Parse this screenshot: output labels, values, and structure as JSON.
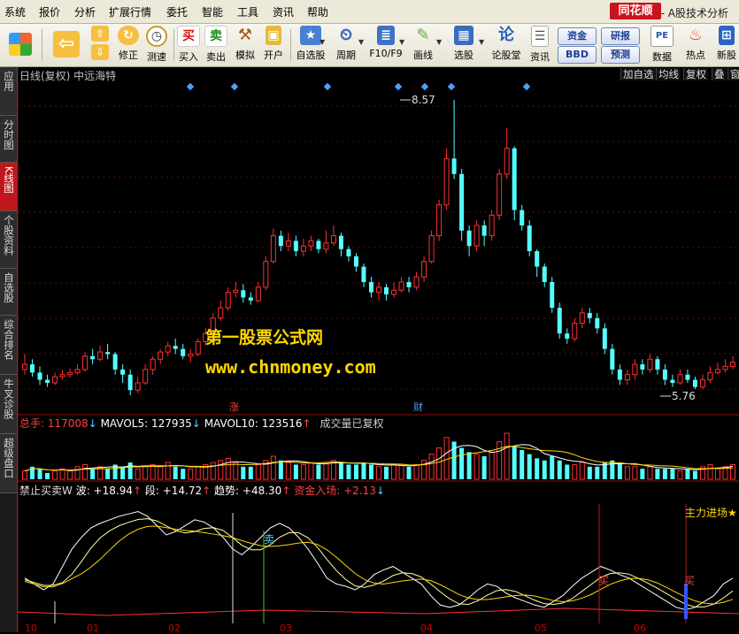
{
  "menu": [
    "系统",
    "报价",
    "分析",
    "扩展行情",
    "委托",
    "智能",
    "工具",
    "资讯",
    "帮助"
  ],
  "brand": "同花顺",
  "window_title": "- A股技术分析",
  "toolbar": {
    "buttons": [
      "买入",
      "卖出",
      "模拟",
      "开户",
      "自选股",
      "周期",
      "F10/F9",
      "画线",
      "选股",
      "论股堂",
      "资讯",
      "数据",
      "热点",
      "新股"
    ],
    "nav": [
      "修正",
      "测速"
    ],
    "pills": [
      "资金",
      "研报",
      "BBD",
      "预测"
    ]
  },
  "sidebar": [
    "应用",
    "分时图",
    "K线图",
    "个股资料",
    "自选股",
    "综合排名",
    "牛叉诊股",
    "超级盘口"
  ],
  "chart": {
    "title": "日线(复权) 中远海特",
    "tabs": [
      "加自选",
      "均线",
      "复权",
      "叠",
      "窗"
    ],
    "high_label": "8.57",
    "low_label": "5.76",
    "event_labels": [
      "涨",
      "财"
    ],
    "cursor_char": "▲"
  },
  "watermark": {
    "line1": "第一股票公式网",
    "line2": "www.chnmoney.com"
  },
  "volume_panel": {
    "total_label": "总手: 117008",
    "mavol5": "MAVOL5: 127935",
    "mavol10": "MAVOL10: 123516",
    "note": "成交量已复权"
  },
  "indicator_panel": {
    "name": "禁止买卖W",
    "wave": "波: +18.94",
    "segment": "段: +14.72",
    "trend": "趋势: +48.30",
    "fund": "资金入场: +2.13",
    "main_force": "主力进场★",
    "sell_label": "卖",
    "buy_label": "买"
  },
  "bottom_axis": [
    "10",
    "01",
    "02",
    "03",
    "04",
    "05",
    "06"
  ],
  "chart_data": {
    "type": "candlestick",
    "high": 8.57,
    "low": 5.76,
    "candles": [
      [
        5.95,
        6.0,
        6.1,
        5.9
      ],
      [
        6.0,
        5.92,
        6.05,
        5.88
      ],
      [
        5.92,
        5.85,
        5.98,
        5.8
      ],
      [
        5.85,
        5.82,
        5.9,
        5.78
      ],
      [
        5.82,
        5.88,
        5.92,
        5.8
      ],
      [
        5.88,
        5.9,
        5.95,
        5.85
      ],
      [
        5.9,
        5.92,
        5.96,
        5.87
      ],
      [
        5.92,
        5.95,
        6.0,
        5.9
      ],
      [
        5.95,
        6.08,
        6.12,
        5.93
      ],
      [
        6.08,
        6.05,
        6.15,
        6.0
      ],
      [
        6.05,
        6.12,
        6.18,
        6.03
      ],
      [
        6.12,
        6.1,
        6.2,
        6.05
      ],
      [
        6.1,
        5.95,
        6.12,
        5.9
      ],
      [
        5.95,
        5.9,
        6.0,
        5.82
      ],
      [
        5.9,
        5.75,
        5.95,
        5.7
      ],
      [
        5.75,
        5.82,
        5.88,
        5.72
      ],
      [
        5.82,
        5.95,
        6.0,
        5.8
      ],
      [
        5.95,
        6.05,
        6.08,
        5.9
      ],
      [
        6.05,
        6.12,
        6.15,
        6.0
      ],
      [
        6.12,
        6.18,
        6.22,
        6.08
      ],
      [
        6.18,
        6.15,
        6.25,
        6.1
      ],
      [
        6.15,
        6.08,
        6.2,
        6.05
      ],
      [
        6.08,
        6.1,
        6.15,
        6.02
      ],
      [
        6.1,
        6.22,
        6.25,
        6.08
      ],
      [
        6.22,
        6.3,
        6.35,
        6.18
      ],
      [
        6.3,
        6.45,
        6.5,
        6.28
      ],
      [
        6.45,
        6.55,
        6.62,
        6.42
      ],
      [
        6.55,
        6.7,
        6.75,
        6.52
      ],
      [
        6.7,
        6.72,
        6.8,
        6.65
      ],
      [
        6.72,
        6.65,
        6.78,
        6.6
      ],
      [
        6.65,
        6.62,
        6.7,
        6.58
      ],
      [
        6.62,
        6.75,
        6.8,
        6.6
      ],
      [
        6.75,
        7.0,
        7.05,
        6.72
      ],
      [
        7.0,
        7.25,
        7.32,
        6.98
      ],
      [
        7.25,
        7.15,
        7.3,
        7.1
      ],
      [
        7.15,
        7.2,
        7.28,
        7.1
      ],
      [
        7.2,
        7.1,
        7.25,
        7.05
      ],
      [
        7.1,
        7.15,
        7.22,
        7.05
      ],
      [
        7.15,
        7.2,
        7.25,
        7.1
      ],
      [
        7.2,
        7.12,
        7.22,
        7.08
      ],
      [
        7.12,
        7.18,
        7.3,
        7.08
      ],
      [
        7.18,
        7.25,
        7.35,
        7.15
      ],
      [
        7.25,
        7.12,
        7.28,
        7.05
      ],
      [
        7.12,
        7.05,
        7.15,
        7.0
      ],
      [
        7.05,
        6.95,
        7.08,
        6.9
      ],
      [
        6.95,
        6.8,
        6.98,
        6.75
      ],
      [
        6.8,
        6.7,
        6.85,
        6.65
      ],
      [
        6.7,
        6.75,
        6.8,
        6.62
      ],
      [
        6.75,
        6.68,
        6.78,
        6.62
      ],
      [
        6.68,
        6.72,
        6.8,
        6.65
      ],
      [
        6.72,
        6.8,
        6.85,
        6.7
      ],
      [
        6.8,
        6.75,
        6.85,
        6.7
      ],
      [
        6.75,
        6.85,
        6.9,
        6.72
      ],
      [
        6.85,
        7.0,
        7.05,
        6.8
      ],
      [
        7.0,
        7.25,
        7.3,
        6.98
      ],
      [
        7.25,
        7.55,
        7.6,
        7.2
      ],
      [
        7.55,
        8.0,
        8.1,
        7.5
      ],
      [
        8.0,
        7.85,
        8.57,
        7.8
      ],
      [
        7.85,
        7.3,
        7.9,
        7.2
      ],
      [
        7.3,
        7.15,
        7.35,
        7.05
      ],
      [
        7.15,
        7.35,
        7.4,
        7.1
      ],
      [
        7.35,
        7.25,
        7.4,
        7.15
      ],
      [
        7.25,
        7.45,
        7.5,
        7.2
      ],
      [
        7.45,
        7.85,
        7.9,
        7.4
      ],
      [
        7.85,
        8.1,
        8.3,
        7.8
      ],
      [
        8.1,
        7.5,
        8.12,
        7.4
      ],
      [
        7.5,
        7.35,
        7.55,
        7.3
      ],
      [
        7.35,
        7.1,
        7.4,
        7.05
      ],
      [
        7.1,
        6.95,
        7.12,
        6.85
      ],
      [
        6.95,
        6.8,
        6.98,
        6.75
      ],
      [
        6.8,
        6.55,
        6.85,
        6.5
      ],
      [
        6.55,
        6.3,
        6.6,
        6.25
      ],
      [
        6.3,
        6.25,
        6.35,
        6.2
      ],
      [
        6.25,
        6.4,
        6.45,
        6.22
      ],
      [
        6.4,
        6.5,
        6.55,
        6.35
      ],
      [
        6.5,
        6.45,
        6.55,
        6.4
      ],
      [
        6.45,
        6.35,
        6.5,
        6.3
      ],
      [
        6.35,
        6.15,
        6.4,
        6.1
      ],
      [
        6.15,
        5.95,
        6.2,
        5.9
      ],
      [
        5.95,
        5.85,
        6.0,
        5.8
      ],
      [
        5.85,
        5.9,
        5.95,
        5.8
      ],
      [
        5.9,
        6.0,
        6.05,
        5.85
      ],
      [
        6.0,
        5.95,
        6.05,
        5.9
      ],
      [
        5.95,
        6.05,
        6.1,
        5.92
      ],
      [
        6.05,
        5.95,
        6.08,
        5.9
      ],
      [
        5.95,
        5.85,
        6.0,
        5.8
      ],
      [
        5.85,
        5.82,
        5.9,
        5.78
      ],
      [
        5.82,
        5.9,
        5.95,
        5.8
      ],
      [
        5.9,
        5.85,
        5.95,
        5.82
      ],
      [
        5.85,
        5.78,
        5.88,
        5.76
      ],
      [
        5.78,
        5.85,
        5.9,
        5.76
      ],
      [
        5.85,
        5.92,
        5.98,
        5.82
      ],
      [
        5.92,
        5.95,
        6.02,
        5.9
      ],
      [
        5.95,
        5.98,
        6.05,
        5.92
      ],
      [
        5.98,
        6.02,
        6.08,
        5.95
      ]
    ],
    "volume": [
      4,
      6,
      5,
      3,
      4,
      5,
      4,
      6,
      7,
      5,
      6,
      5,
      7,
      6,
      8,
      5,
      6,
      7,
      6,
      8,
      6,
      5,
      5,
      6,
      7,
      8,
      9,
      10,
      8,
      6,
      6,
      7,
      9,
      11,
      9,
      8,
      7,
      7,
      8,
      7,
      8,
      9,
      8,
      7,
      7,
      8,
      7,
      6,
      6,
      7,
      7,
      6,
      7,
      9,
      12,
      15,
      20,
      18,
      15,
      13,
      12,
      11,
      13,
      18,
      22,
      16,
      14,
      12,
      10,
      9,
      11,
      9,
      7,
      7,
      8,
      6,
      6,
      8,
      9,
      8,
      6,
      6,
      5,
      6,
      5,
      5,
      5,
      4,
      5,
      4,
      6,
      7,
      5,
      6,
      7
    ],
    "indicator": [
      0.35,
      0.3,
      0.25,
      0.3,
      0.45,
      0.6,
      0.7,
      0.78,
      0.82,
      0.85,
      0.88,
      0.9,
      0.92,
      0.88,
      0.8,
      0.72,
      0.75,
      0.8,
      0.85,
      0.83,
      0.78,
      0.7,
      0.6,
      0.55,
      0.62,
      0.7,
      0.78,
      0.82,
      0.78,
      0.7,
      0.6,
      0.48,
      0.35,
      0.3,
      0.28,
      0.25,
      0.3,
      0.38,
      0.42,
      0.45,
      0.4,
      0.35,
      0.3,
      0.2,
      0.12,
      0.1,
      0.12,
      0.18,
      0.25,
      0.3,
      0.28,
      0.22,
      0.18,
      0.15,
      0.12,
      0.1,
      0.15,
      0.2,
      0.28,
      0.35,
      0.4,
      0.45,
      0.42,
      0.38,
      0.35,
      0.3,
      0.25,
      0.2,
      0.15,
      0.1,
      0.08,
      0.1,
      0.15,
      0.2,
      0.3,
      0.35
    ]
  }
}
